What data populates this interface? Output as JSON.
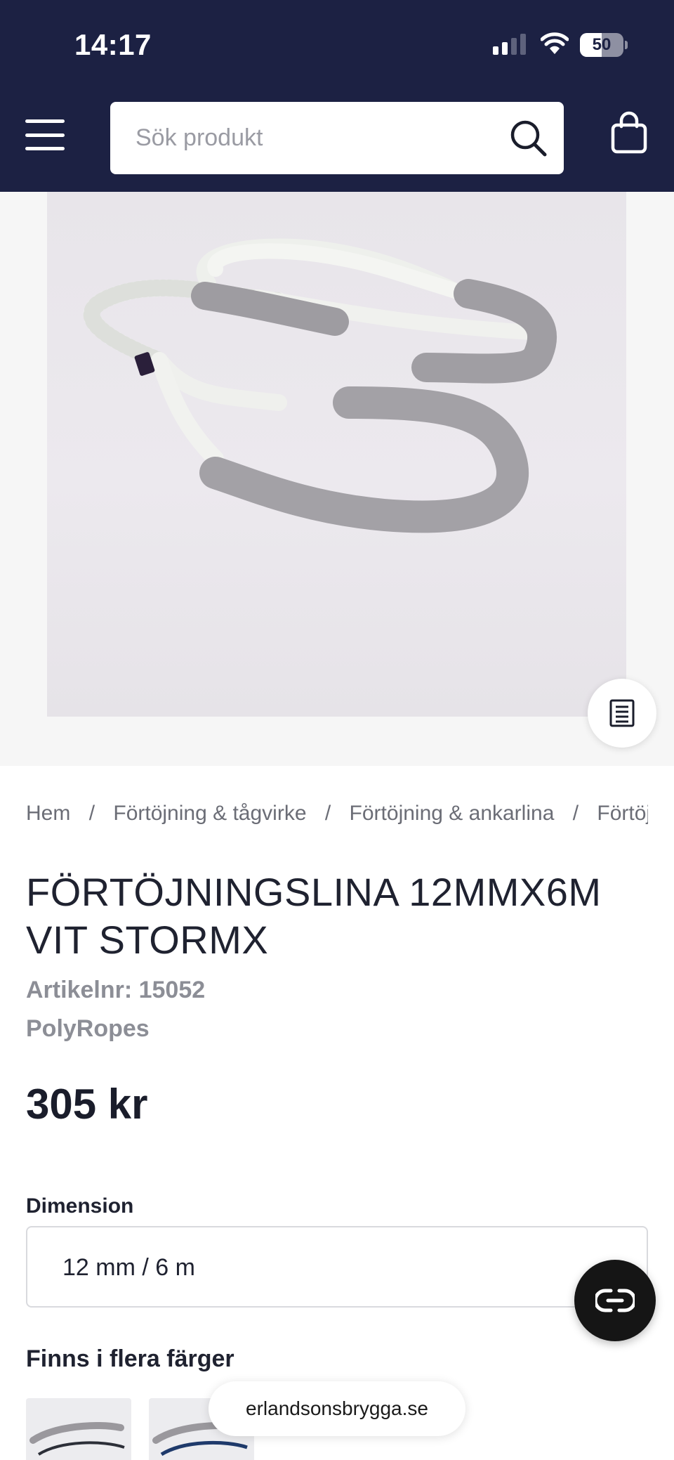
{
  "status_bar": {
    "time": "14:17",
    "battery": "50",
    "battery_level": 0.5
  },
  "header": {
    "search_placeholder": "Sök produkt",
    "icons": [
      "menu-icon",
      "search-icon",
      "cart-icon"
    ]
  },
  "breadcrumb": {
    "items": [
      "Hem",
      "Förtöjning & tågvirke",
      "Förtöjning & ankarlina",
      "Förtöjningslina"
    ],
    "separator": "/"
  },
  "product": {
    "title": "FÖRTÖJNINGSLINA 12MMX6M VIT STORMX",
    "sku": "Artikelnr: 15052",
    "brand": "PolyRopes",
    "price": "305 kr"
  },
  "options": {
    "dimension_label": "Dimension",
    "dimension_value": "12 mm / 6 m",
    "colors_label": "Finns i flera färger"
  },
  "browser": {
    "url": "erlandsonsbrygga.se"
  },
  "colors": {
    "header_bg": "#1c2143",
    "text": "#1f2230",
    "muted": "#8c8e96"
  }
}
